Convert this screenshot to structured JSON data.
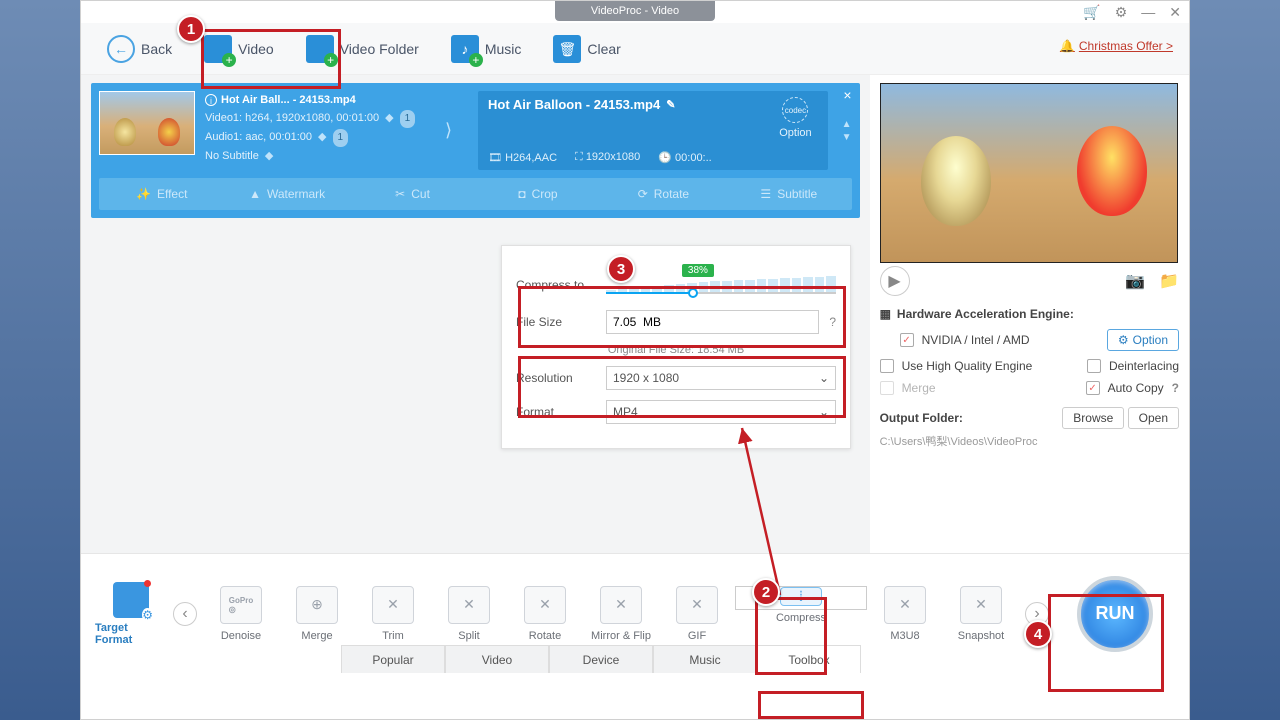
{
  "app": {
    "title": "VideoProc - Video"
  },
  "topbar": {
    "back": "Back",
    "video": "Video",
    "video_folder": "Video Folder",
    "music": "Music",
    "clear": "Clear",
    "offer": "Christmas Offer >"
  },
  "card": {
    "src_title": "Hot Air Ball... - 24153.mp4",
    "video_line": "Video1: h264, 1920x1080, 00:01:00",
    "audio_line": "Audio1: aac, 00:01:00",
    "sub_line": "No Subtitle",
    "badge": "1",
    "out_title": "Hot Air Balloon - 24153.mp4",
    "out_codec": "H264,AAC",
    "out_res": "1920x1080",
    "out_dur": "00:00:..",
    "option_label": "Option",
    "tools": {
      "effect": "Effect",
      "watermark": "Watermark",
      "cut": "Cut",
      "crop": "Crop",
      "rotate": "Rotate",
      "subtitle": "Subtitle"
    }
  },
  "panel": {
    "compress_label": "Compress to",
    "percent": "38%",
    "filesize_label": "File Size",
    "filesize_value": "7.05  MB",
    "original": "Original File Size: 18.54 MB",
    "res_label": "Resolution",
    "res_value": "1920 x 1080",
    "fmt_label": "Format",
    "fmt_value": "MP4"
  },
  "preview": {
    "hw_title": "Hardware Acceleration Engine:",
    "nvidia": "NVIDIA / Intel / AMD",
    "option": "Option",
    "hq": "Use High Quality Engine",
    "deint": "Deinterlacing",
    "merge": "Merge",
    "autocopy": "Auto Copy",
    "of_label": "Output Folder:",
    "browse": "Browse",
    "open": "Open",
    "of_path": "C:\\Users\\鸭梨\\Videos\\VideoProc"
  },
  "bottom": {
    "target_format": "Target Format",
    "items": {
      "denoise": "Denoise",
      "merge": "Merge",
      "trim": "Trim",
      "split": "Split",
      "rotate": "Rotate",
      "mirror": "Mirror & Flip",
      "gif": "GIF",
      "compress": "Compress",
      "m3u8": "M3U8",
      "snapshot": "Snapshot"
    },
    "tabs": {
      "popular": "Popular",
      "video": "Video",
      "device": "Device",
      "music": "Music",
      "toolbox": "Toolbox"
    },
    "run": "RUN"
  },
  "annot": {
    "n1": "1",
    "n2": "2",
    "n3": "3",
    "n4": "4"
  }
}
